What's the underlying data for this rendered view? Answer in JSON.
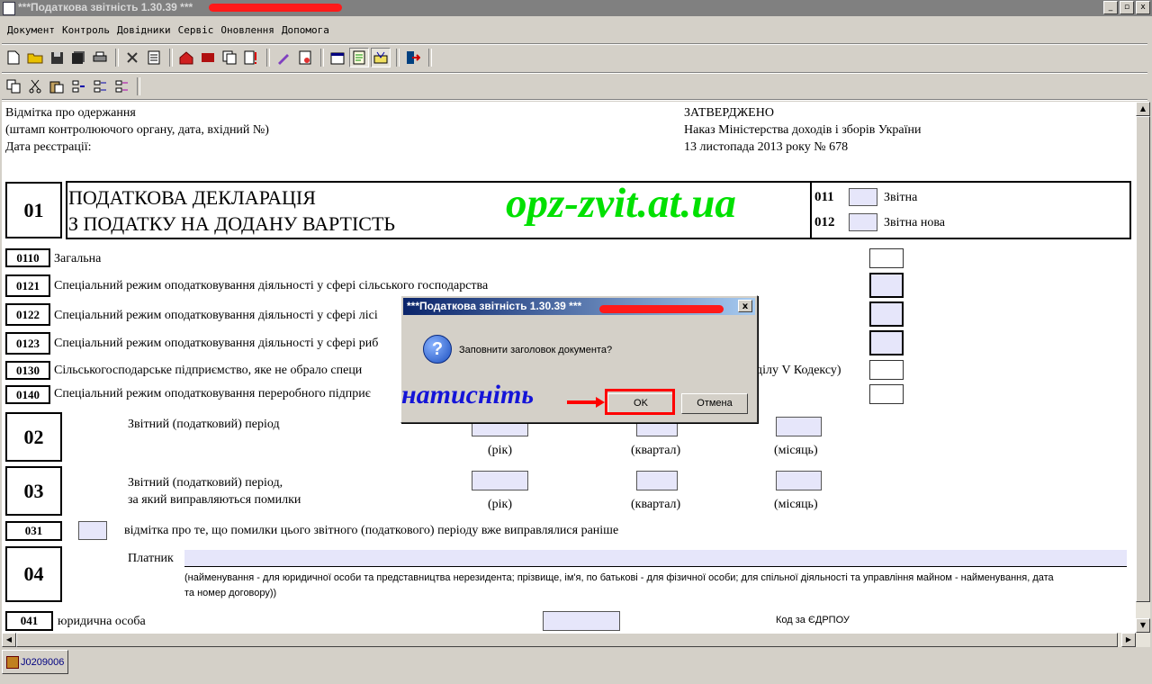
{
  "window": {
    "title": "***Податкова звітність 1.30.39 ***",
    "controls": [
      "_",
      "▫",
      "x"
    ]
  },
  "menu": [
    "Документ",
    "Контроль",
    "Довідники",
    "Сервіс",
    "Оновлення",
    "Допомога"
  ],
  "doc": {
    "header_left": [
      "Відмітка про одержання",
      "(штамп контролюючого органу, дата, вхідний №)",
      "Дата реєстрації:"
    ],
    "header_right": [
      "ЗАТВЕРДЖЕНО",
      "Наказ Міністерства доходів і зборів України",
      "13 листопада 2013 року № 678"
    ],
    "section01": {
      "code": "01",
      "title_line1": "ПОДАТКОВА ДЕКЛАРАЦІЯ",
      "title_line2": "З ПОДАТКУ НА ДОДАНУ ВАРТІСТЬ",
      "watermark": "opz-zvit.at.ua",
      "c011": "011",
      "c011_label": "Звітна",
      "c012": "012",
      "c012_label": "Звітна нова"
    },
    "rows": [
      {
        "code": "0110",
        "label": "Загальна"
      },
      {
        "code": "0121",
        "label": "Спеціальний режим оподатковування діяльності у сфері сільського господарства"
      },
      {
        "code": "0122",
        "label": "Спеціальний режим оподатковування діяльності у сфері лісі"
      },
      {
        "code": "0123",
        "label": "Спеціальний режим оподатковування діяльності у сфері риб"
      },
      {
        "code": "0130",
        "label": "Сільськогосподарське підприємство, яке не обрало специ",
        "label_tail": "ділу V Кодексу)"
      },
      {
        "code": "0140",
        "label": "Спеціальний режим оподатковування переробного підприє"
      }
    ],
    "s02": {
      "code": "02",
      "label": "Звітний (податковий) період",
      "year": "(рік)",
      "quarter": "(квартал)",
      "month": "(місяць)"
    },
    "s03": {
      "code": "03",
      "label1": "Звітний (податковий) період,",
      "label2": "за який виправляються помилки",
      "year": "(рік)",
      "quarter": "(квартал)",
      "month": "(місяць)"
    },
    "s031": {
      "code": "031",
      "label": "відмітка про те, що помилки цього звітного (податкового) періоду вже виправлялися раніше"
    },
    "s04": {
      "code": "04",
      "payer": "Платник",
      "note1": "(найменування - для юридичної особи та представництва нерезидента; прізвище, ім'я, по батькові - для фізичної особи; для спільної діяльності та управління майном - найменування, дата",
      "note2": "та номер договору))"
    },
    "s041": {
      "code": "041",
      "label": "юридична особа",
      "edrpou": "Код за ЄДРПОУ"
    }
  },
  "dialog": {
    "title": "***Податкова звітність 1.30.39 ***",
    "message": "Заповнити заголовок документа?",
    "ok": "OK",
    "cancel": "Отмена",
    "annotation": "натисніть"
  },
  "statusbar": {
    "tab": "J0209006"
  },
  "colors": {
    "highlight": "#ff0000",
    "watermark": "#00e000",
    "annotation": "#1414d8",
    "input_fill": "#e6e6fa"
  }
}
